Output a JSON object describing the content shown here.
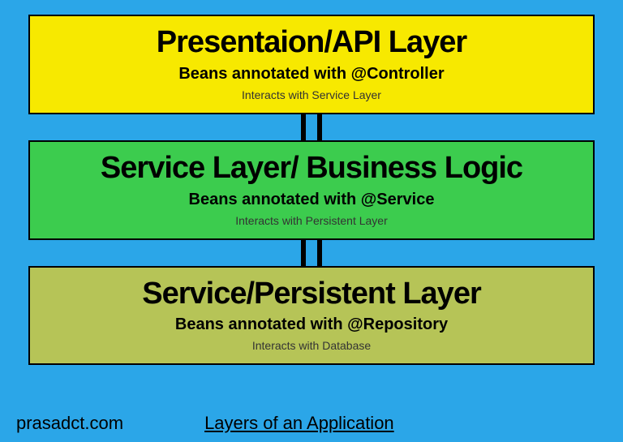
{
  "layers": {
    "presentation": {
      "title": "Presentaion/API Layer",
      "subtitle": "Beans annotated with @Controller",
      "note": "Interacts with Service Layer"
    },
    "service": {
      "title": "Service Layer/ Business Logic",
      "subtitle": "Beans annotated with @Service",
      "note": "Interacts with Persistent Layer"
    },
    "persistent": {
      "title": "Service/Persistent Layer",
      "subtitle": "Beans annotated with @Repository",
      "note": "Interacts with Database"
    }
  },
  "footer": {
    "site": "prasadct.com",
    "caption": "Layers of an Application"
  }
}
